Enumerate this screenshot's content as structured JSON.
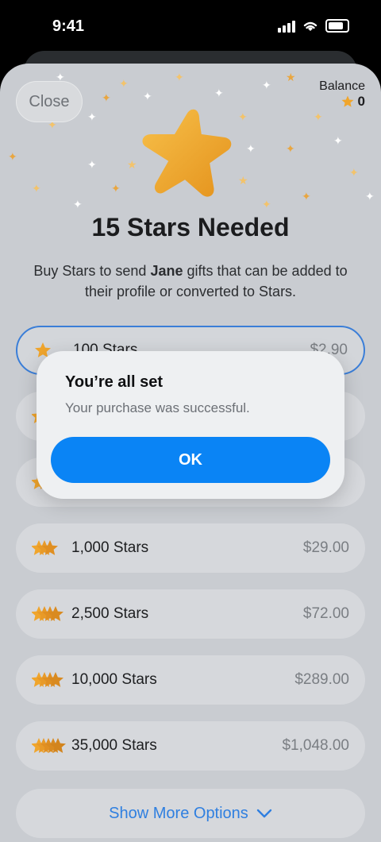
{
  "status": {
    "time": "9:41"
  },
  "header": {
    "close_label": "Close",
    "balance_label": "Balance",
    "balance_value": "0"
  },
  "title": "15 Stars Needed",
  "subtitle": {
    "pre": "Buy Stars to send ",
    "name": "Jane",
    "post": " gifts that can be added to their profile or converted to Stars."
  },
  "options": [
    {
      "label": "100 Stars",
      "price": "$2.90",
      "stars": 1
    },
    {
      "label": "",
      "price": "",
      "stars": 2
    },
    {
      "label": "",
      "price": "",
      "stars": 2
    },
    {
      "label": "1,000 Stars",
      "price": "$29.00",
      "stars": 3
    },
    {
      "label": "2,500 Stars",
      "price": "$72.00",
      "stars": 4
    },
    {
      "label": "10,000 Stars",
      "price": "$289.00",
      "stars": 4
    },
    {
      "label": "35,000 Stars",
      "price": "$1,048.00",
      "stars": 5
    }
  ],
  "more_label": "Show More Options",
  "alert": {
    "title": "You’re all set",
    "message": "Your purchase was successful.",
    "ok_label": "OK"
  },
  "colors": {
    "accent": "#0a84f5",
    "star": "#f0a52c",
    "link": "#2f7fe0"
  },
  "icons": {
    "star": "star-icon",
    "chevron": "chevron-down-icon",
    "wifi": "wifi-icon",
    "battery": "battery-icon",
    "signal": "signal-icon"
  }
}
